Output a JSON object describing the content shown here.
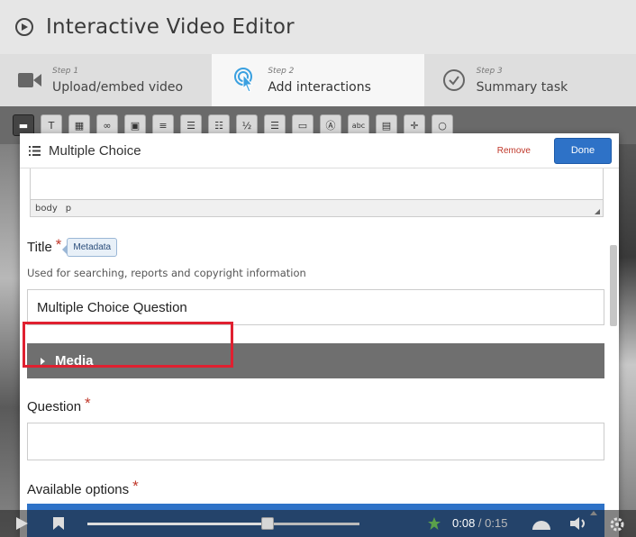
{
  "header": {
    "title": "Interactive Video Editor"
  },
  "steps": [
    {
      "num": "Step 1",
      "label": "Upload/embed video",
      "icon": "video-camera-icon"
    },
    {
      "num": "Step 2",
      "label": "Add interactions",
      "icon": "touch-pointer-icon"
    },
    {
      "num": "Step 3",
      "label": "Summary task",
      "icon": "check-circle-icon"
    }
  ],
  "toolbar": {
    "text_tool": "T",
    "abc_tool": "abc"
  },
  "dialog": {
    "title": "Multiple Choice",
    "remove_label": "Remove",
    "done_label": "Done",
    "editor_path": [
      "body",
      "p"
    ],
    "title_field": {
      "label": "Title",
      "required": "*",
      "badge": "Metadata",
      "description": "Used for searching, reports and copyright information",
      "value": "Multiple Choice Question"
    },
    "media_label": "Media",
    "question_field": {
      "label": "Question",
      "required": "*",
      "value": ""
    },
    "options_field": {
      "label": "Available options",
      "required": "*"
    }
  },
  "player": {
    "current": "0:08",
    "separator": " / ",
    "duration": "0:15"
  },
  "colors": {
    "accent": "#2e72c7",
    "required": "#c0392b",
    "highlight": "#e02030",
    "media_bar": "#6f6f6f"
  }
}
